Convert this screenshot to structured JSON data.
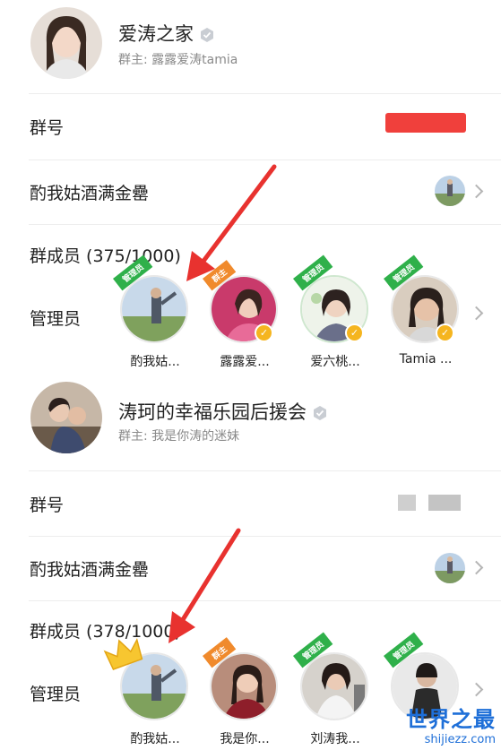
{
  "groups": [
    {
      "name": "爱涛之家",
      "owner": "群主: 露露爱涛tamia",
      "group_number_label": "群号",
      "group_number_value": "",
      "subgroup_label": "酌我姑酒满金罍",
      "members_label": "群成员 (375/1000)",
      "admins_label": "管理员",
      "members": [
        {
          "name": "酌我姑...",
          "role": "管理员",
          "verified": false
        },
        {
          "name": "露露爱...",
          "role": "群主",
          "verified": true
        },
        {
          "name": "爱六桃...",
          "role": "管理员",
          "verified": true
        },
        {
          "name": "Tamia ...",
          "role": "管理员",
          "verified": true
        }
      ]
    },
    {
      "name": "涛珂的幸福乐园后援会",
      "owner": "群主: 我是你涛的迷妹",
      "group_number_label": "群号",
      "group_number_value": "",
      "subgroup_label": "酌我姑酒满金罍",
      "members_label": "群成员 (378/1000)",
      "admins_label": "管理员",
      "members": [
        {
          "name": "酌我姑...",
          "role": "",
          "verified": false
        },
        {
          "name": "我是你...",
          "role": "群主",
          "verified": false
        },
        {
          "name": "刘涛我...",
          "role": "管理员",
          "verified": false
        },
        {
          "name": "",
          "role": "管理员",
          "verified": false
        }
      ]
    }
  ],
  "watermark": {
    "title": "世界之最",
    "url": "shijiezz.com"
  },
  "colors": {
    "admin": "#2fb04a",
    "owner": "#f08a2c",
    "verified": "#f5b51f",
    "arrow": "#e8322f",
    "link": "#1e6fd8"
  }
}
